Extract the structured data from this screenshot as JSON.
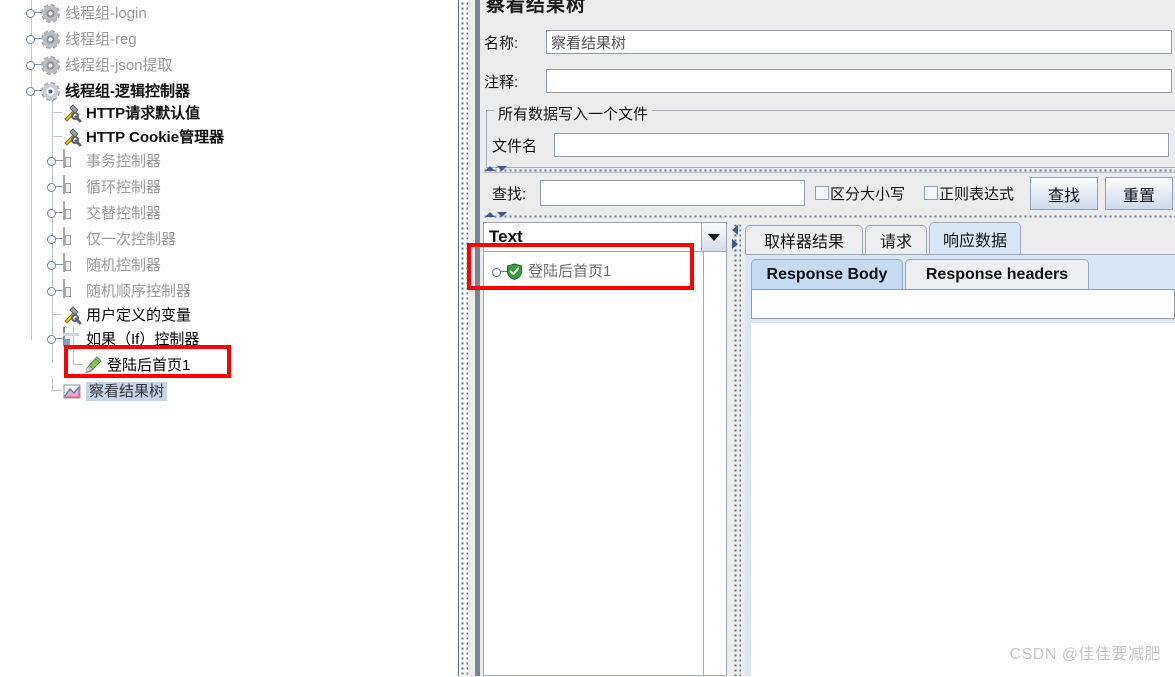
{
  "tree": {
    "items": [
      {
        "label": "线程组-login",
        "icon": "gear-icon",
        "state": "dim",
        "indent": 1,
        "expandable": true
      },
      {
        "label": "线程组-reg",
        "icon": "gear-icon",
        "state": "dim",
        "indent": 1,
        "expandable": true
      },
      {
        "label": "线程组-json提取",
        "icon": "gear-icon",
        "state": "dim",
        "indent": 1,
        "expandable": true
      },
      {
        "label": "线程组-逻辑控制器",
        "icon": "gear-icon-active",
        "state": "bold",
        "indent": 1,
        "expandable": true
      },
      {
        "label": "HTTP请求默认值",
        "icon": "tools-icon",
        "state": "bold",
        "indent": 2,
        "expandable": false
      },
      {
        "label": "HTTP Cookie管理器",
        "icon": "tools-icon",
        "state": "bold",
        "indent": 2,
        "expandable": false
      },
      {
        "label": "事务控制器",
        "icon": "controller-icon",
        "state": "dim",
        "indent": 2,
        "expandable": true
      },
      {
        "label": "循环控制器",
        "icon": "controller-icon",
        "state": "dim",
        "indent": 2,
        "expandable": true
      },
      {
        "label": "交替控制器",
        "icon": "controller-icon",
        "state": "dim",
        "indent": 2,
        "expandable": true
      },
      {
        "label": "仅一次控制器",
        "icon": "controller-icon",
        "state": "dim",
        "indent": 2,
        "expandable": true
      },
      {
        "label": "随机控制器",
        "icon": "controller-icon",
        "state": "dim",
        "indent": 2,
        "expandable": true
      },
      {
        "label": "随机顺序控制器",
        "icon": "controller-icon",
        "state": "dim",
        "indent": 2,
        "expandable": true
      },
      {
        "label": "用户定义的变量",
        "icon": "tools-icon",
        "state": "normal",
        "indent": 2,
        "expandable": false
      },
      {
        "label": "如果（If）控制器",
        "icon": "if-controller-icon",
        "state": "normal",
        "indent": 2,
        "expandable": true
      },
      {
        "label": "登陆后首页1",
        "icon": "pencil-icon",
        "state": "normal",
        "indent": 3,
        "expandable": false
      },
      {
        "label": "察看结果树",
        "icon": "results-tree-icon",
        "state": "selected",
        "indent": 2,
        "expandable": false
      }
    ]
  },
  "panel": {
    "title": "察看结果树",
    "name_label": "名称:",
    "name_value": "察看结果树",
    "comment_label": "注释:",
    "comment_value": "",
    "file_group_legend": "所有数据写入一个文件",
    "filename_label": "文件名",
    "filename_value": ""
  },
  "search": {
    "label": "查找:",
    "value": "",
    "case_sensitive_label": "区分大小写",
    "case_sensitive_checked": false,
    "regex_label": "正则表达式",
    "regex_checked": false,
    "find_button": "查找",
    "reset_button": "重置"
  },
  "results": {
    "view_selector_value": "Text",
    "items": [
      {
        "label": "登陆后首页1",
        "status": "success"
      }
    ]
  },
  "detail_tabs": {
    "items": [
      {
        "label": "取样器结果",
        "selected": false
      },
      {
        "label": "请求",
        "selected": false
      },
      {
        "label": "响应数据",
        "selected": true
      }
    ]
  },
  "response_tabs": {
    "items": [
      {
        "label": "Response Body",
        "selected": true
      },
      {
        "label": "Response headers",
        "selected": false
      }
    ]
  },
  "response_body": {
    "field_value": ""
  },
  "watermark": {
    "text": "CSDN @佳佳要减肥"
  },
  "colors": {
    "accent": "#3c5a8a",
    "annotation": "#ff0000",
    "panel_bg": "#ececec",
    "tab_selected": "#d9e6f5",
    "selection": "#c5d4e8"
  }
}
